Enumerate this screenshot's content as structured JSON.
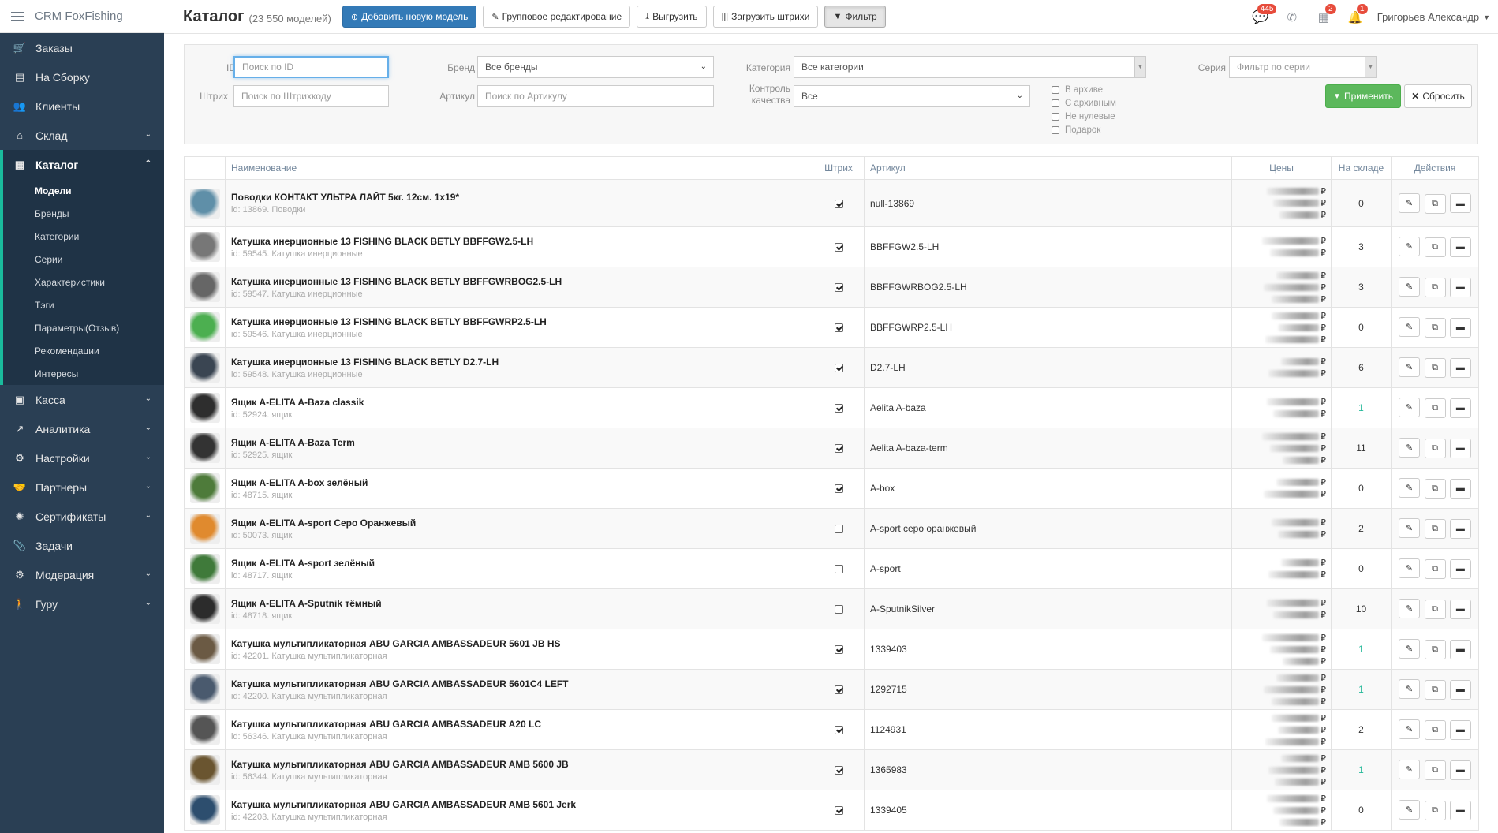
{
  "app": {
    "title": "CRM FoxFishing"
  },
  "sidebar": {
    "items": [
      {
        "label": "Заказы",
        "icon": "cart-icon",
        "glyph": "🛒",
        "chevron": false
      },
      {
        "label": "На Сборку",
        "icon": "inbox-icon",
        "glyph": "▤",
        "chevron": false
      },
      {
        "label": "Клиенты",
        "icon": "users-icon",
        "glyph": "👥",
        "chevron": false
      },
      {
        "label": "Склад",
        "icon": "home-icon",
        "glyph": "⌂",
        "chevron": true
      },
      {
        "label": "Каталог",
        "icon": "list-icon",
        "glyph": "▦",
        "chevron": true,
        "active": true
      }
    ],
    "catalog_sub": [
      "Модели",
      "Бренды",
      "Категории",
      "Серии",
      "Характеристики",
      "Тэги",
      "Параметры(Отзыв)",
      "Рекомендации",
      "Интересы"
    ],
    "items_after": [
      {
        "label": "Касса",
        "icon": "cash-icon",
        "glyph": "▣",
        "chevron": true
      },
      {
        "label": "Аналитика",
        "icon": "chart-icon",
        "glyph": "↗",
        "chevron": true
      },
      {
        "label": "Настройки",
        "icon": "gears-icon",
        "glyph": "⚙",
        "chevron": true
      },
      {
        "label": "Партнеры",
        "icon": "handshake-icon",
        "glyph": "🤝",
        "chevron": true
      },
      {
        "label": "Сертификаты",
        "icon": "certificate-icon",
        "glyph": "✺",
        "chevron": true
      },
      {
        "label": "Задачи",
        "icon": "paperclip-icon",
        "glyph": "📎",
        "chevron": false
      },
      {
        "label": "Модерация",
        "icon": "cogs-icon",
        "glyph": "⚙",
        "chevron": true
      },
      {
        "label": "Гуру",
        "icon": "walking-icon",
        "glyph": "🚶",
        "chevron": true
      }
    ]
  },
  "header": {
    "title": "Каталог",
    "count": "(23 550 моделей)",
    "add_label": "Добавить новую модель",
    "group_edit_label": "Групповое редактирование",
    "export_label": "Выгрузить",
    "barcodes_label": "Загрузить штрихи",
    "filter_label": "Фильтр",
    "badges": {
      "messages": "445",
      "tasks": "2",
      "notifications": "1"
    },
    "user": "Григорьев Александр"
  },
  "filter": {
    "id_label": "ID",
    "id_placeholder": "Поиск по ID",
    "barcode_label": "Штрих",
    "barcode_placeholder": "Поиск по Штрихкоду",
    "brand_label": "Бренд",
    "brand_value": "Все бренды",
    "article_label": "Артикул",
    "article_placeholder": "Поиск по Артикулу",
    "category_label": "Категория",
    "category_value": "Все категории",
    "quality_label_1": "Контроль",
    "quality_label_2": "качества",
    "quality_value": "Все",
    "series_label": "Серия",
    "series_placeholder": "Фильтр по серии",
    "checks": [
      "В архиве",
      "С архивным",
      "Не нулевые",
      "Подарок"
    ],
    "apply_label": "Применить",
    "reset_label": "Сбросить"
  },
  "table": {
    "headers": [
      "",
      "Наименование",
      "Штрих",
      "Артикул",
      "Цены",
      "На складе",
      "Действия"
    ],
    "rows": [
      {
        "name": "Поводки КОНТАКТ УЛЬТРА ЛАЙТ 5кг. 12см. 1х19*",
        "sub": "id: 13869. Поводки",
        "barcode": true,
        "article": "null-13869",
        "prices": 3,
        "stock": "0",
        "thumb": "#5f8fa8"
      },
      {
        "name": "Катушка инерционные 13 FISHING BLACK BETLY BBFFGW2.5-LH",
        "sub": "id: 59545. Катушка инерционные",
        "barcode": true,
        "article": "BBFFGW2.5-LH",
        "prices": 2,
        "stock": "3",
        "thumb": "#777"
      },
      {
        "name": "Катушка инерционные 13 FISHING BLACK BETLY BBFFGWRBOG2.5-LH",
        "sub": "id: 59547. Катушка инерционные",
        "barcode": true,
        "article": "BBFFGWRBOG2.5-LH",
        "prices": 3,
        "stock": "3",
        "thumb": "#666"
      },
      {
        "name": "Катушка инерционные 13 FISHING BLACK BETLY BBFFGWRP2.5-LH",
        "sub": "id: 59546. Катушка инерционные",
        "barcode": true,
        "article": "BBFFGWRP2.5-LH",
        "prices": 3,
        "stock": "0",
        "thumb": "#4caf50"
      },
      {
        "name": "Катушка инерционные 13 FISHING BLACK BETLY D2.7-LH",
        "sub": "id: 59548. Катушка инерционные",
        "barcode": true,
        "article": "D2.7-LH",
        "prices": 2,
        "stock": "6",
        "thumb": "#3a4552"
      },
      {
        "name": "Ящик A-ELITA A-Baza classik",
        "sub": "id: 52924. ящик",
        "barcode": true,
        "article": "Aelita A-baza",
        "prices": 2,
        "stock": "1",
        "stock_green": true,
        "thumb": "#2e2e2e"
      },
      {
        "name": "Ящик A-ELITA A-Baza Term",
        "sub": "id: 52925. ящик",
        "barcode": true,
        "article": "Aelita A-baza-term",
        "prices": 3,
        "stock": "11",
        "thumb": "#333"
      },
      {
        "name": "Ящик A-ELITA A-box зелёный",
        "sub": "id: 48715. ящик",
        "barcode": true,
        "article": "A-box",
        "prices": 2,
        "stock": "0",
        "thumb": "#4e7b3a"
      },
      {
        "name": "Ящик A-ELITA A-sport Серо Оранжевый",
        "sub": "id: 50073. ящик",
        "barcode": false,
        "article": "A-sport серо оранжевый",
        "prices": 2,
        "stock": "2",
        "thumb": "#e08a2e"
      },
      {
        "name": "Ящик A-ELITA A-sport зелёный",
        "sub": "id: 48717. ящик",
        "barcode": false,
        "article": "A-sport",
        "prices": 2,
        "stock": "0",
        "thumb": "#3f7a3a"
      },
      {
        "name": "Ящик A-ELITA A-Sputnik тёмный",
        "sub": "id: 48718. ящик",
        "barcode": false,
        "article": "A-SputnikSilver",
        "prices": 2,
        "stock": "10",
        "thumb": "#2c2c2c"
      },
      {
        "name": "Катушка мультипликаторная ABU GARCIA AMBASSADEUR 5601 JB HS",
        "sub": "id: 42201. Катушка мультипликаторная",
        "barcode": true,
        "article": "1339403",
        "prices": 3,
        "stock": "1",
        "stock_green": true,
        "thumb": "#6b5a44"
      },
      {
        "name": "Катушка мультипликаторная ABU GARCIA AMBASSADEUR 5601C4 LEFT",
        "sub": "id: 42200. Катушка мультипликаторная",
        "barcode": true,
        "article": "1292715",
        "prices": 3,
        "stock": "1",
        "stock_green": true,
        "thumb": "#4a5a6e"
      },
      {
        "name": "Катушка мультипликаторная ABU GARCIA AMBASSADEUR A20 LC",
        "sub": "id: 56346. Катушка мультипликаторная",
        "barcode": true,
        "article": "1124931",
        "prices": 3,
        "stock": "2",
        "thumb": "#555"
      },
      {
        "name": "Катушка мультипликаторная ABU GARCIA AMBASSADEUR AMB 5600 JB",
        "sub": "id: 56344. Катушка мультипликаторная",
        "barcode": true,
        "article": "1365983",
        "prices": 3,
        "stock": "1",
        "stock_green": true,
        "thumb": "#6a5530"
      },
      {
        "name": "Катушка мультипликаторная ABU GARCIA AMBASSADEUR AMB 5601 Jerk",
        "sub": "id: 42203. Катушка мультипликаторная",
        "barcode": true,
        "article": "1339405",
        "prices": 3,
        "stock": "0",
        "thumb": "#2d4e6e"
      }
    ],
    "currency": "₽"
  },
  "colors": {
    "sidebar_bg": "#2a3f54",
    "accent": "#1abb9c",
    "primary": "#337ab7",
    "success": "#5cb85c",
    "badge": "#e74c3c"
  }
}
